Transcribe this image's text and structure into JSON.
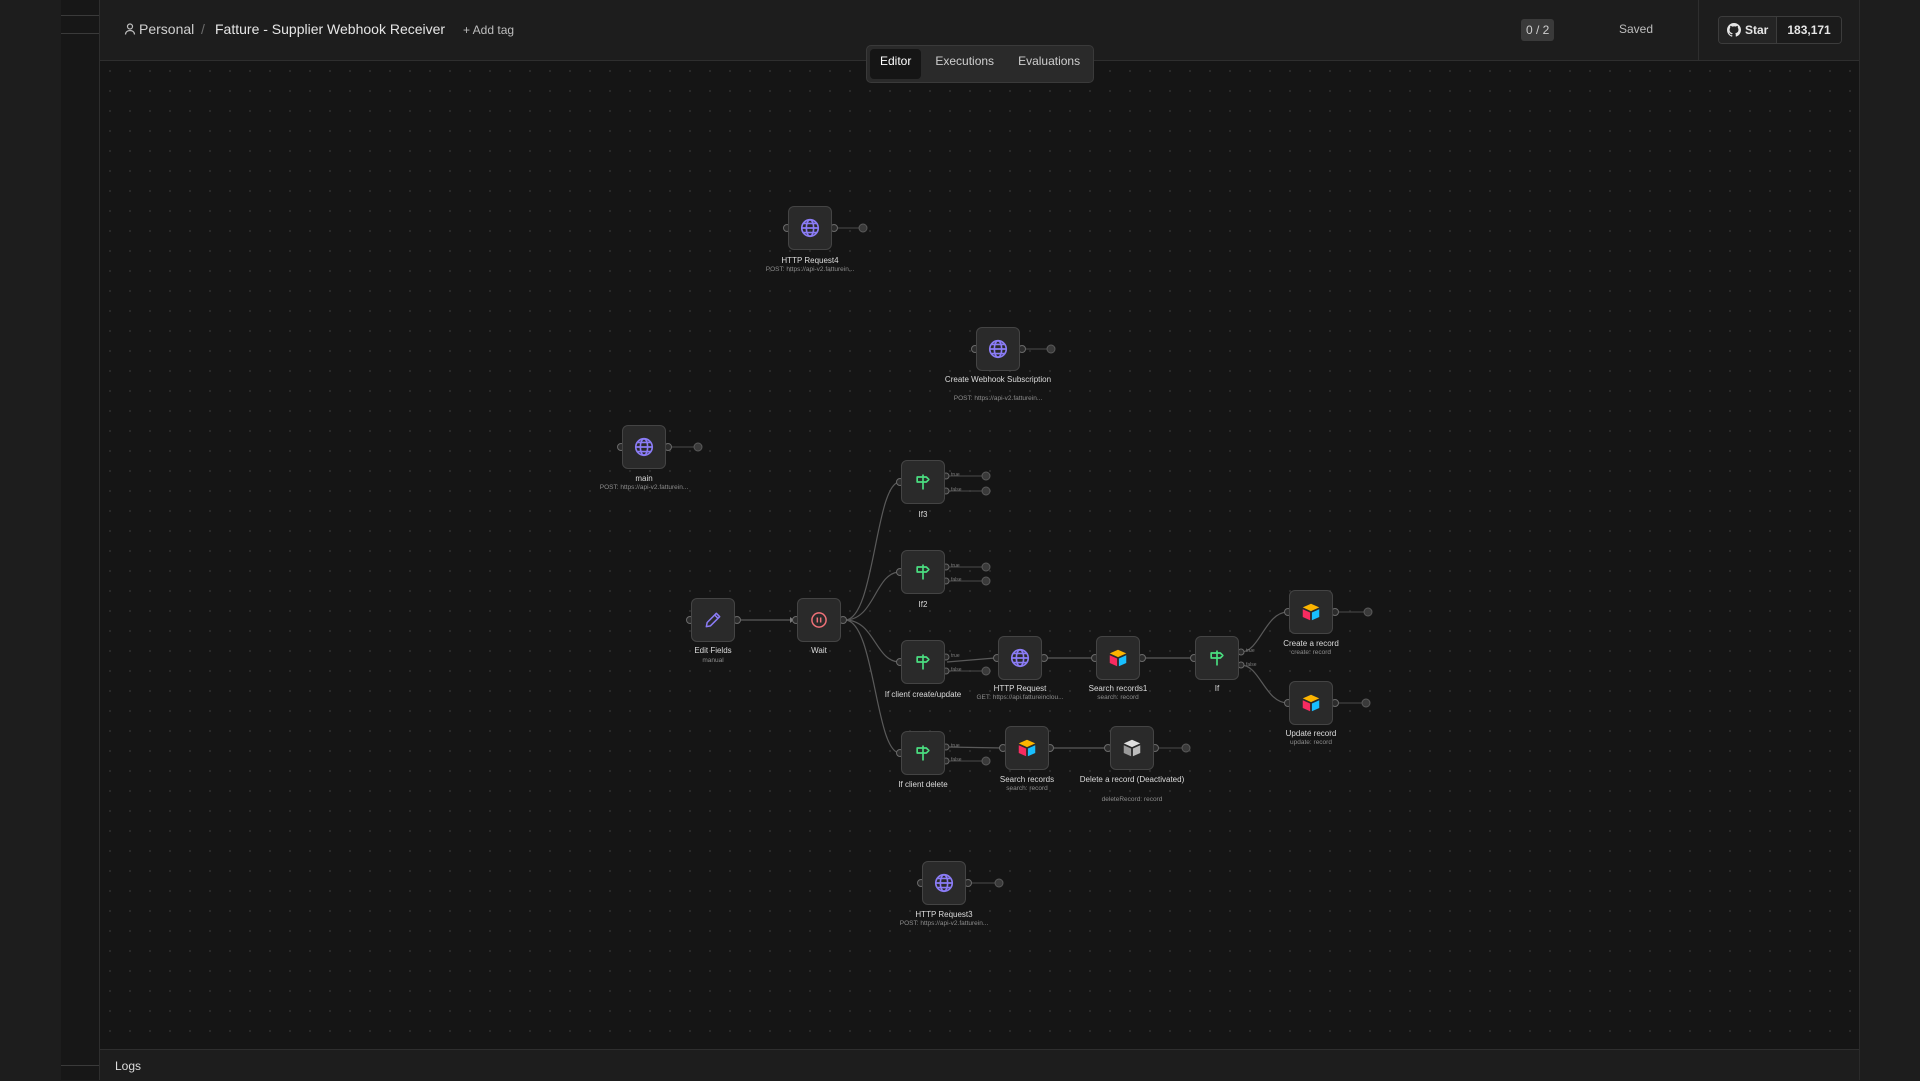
{
  "header": {
    "project": "Personal",
    "separator": "/",
    "workflow_title": "Fatture - Supplier Webhook Receiver",
    "add_tag": "+ Add tag",
    "counter": "0 / 2",
    "status": "Saved",
    "github_star": "Star",
    "github_count": "183,171"
  },
  "tabs": [
    "Editor",
    "Executions",
    "Evaluations"
  ],
  "active_tab": "Editor",
  "nodes": {
    "http_request4": {
      "label": "HTTP Request4",
      "sub": "POST: https://api-v2.fatturein..."
    },
    "create_webhook_subscription": {
      "label": "Create Webhook Subscription",
      "sub": "POST: https://api-v2.fatturein..."
    },
    "main": {
      "label": "main",
      "sub": "POST: https://api-v2.fatturein..."
    },
    "if3": {
      "label": "If3",
      "sub": ""
    },
    "if2": {
      "label": "If2",
      "sub": ""
    },
    "edit_fields": {
      "label": "Edit Fields",
      "sub": "manual"
    },
    "wait": {
      "label": "Wait",
      "sub": ""
    },
    "if_client_create_update": {
      "label": "If client create/update",
      "sub": ""
    },
    "http_request": {
      "label": "HTTP Request",
      "sub": "GET: https://api.fattureinclou..."
    },
    "search_records1": {
      "label": "Search records1",
      "sub": "search: record"
    },
    "if": {
      "label": "If",
      "sub": ""
    },
    "create_a_record": {
      "label": "Create a record",
      "sub": "create: record"
    },
    "update_record": {
      "label": "Update record",
      "sub": "update: record"
    },
    "if_client_delete": {
      "label": "If client delete",
      "sub": ""
    },
    "search_records": {
      "label": "Search records",
      "sub": "search: record"
    },
    "delete_a_record": {
      "label": "Delete a record (Deactivated)",
      "sub": "deleteRecord: record"
    },
    "http_request3": {
      "label": "HTTP Request3",
      "sub": "POST: https://api-v2.fatturein..."
    }
  },
  "port_labels": {
    "true": "true",
    "false": "false"
  },
  "footer": {
    "logs": "Logs"
  },
  "colors": {
    "http_icon": "#8b7cf6",
    "if_icon": "#4ade80",
    "edit_icon": "#8b7cf6",
    "wait_icon": "#f07178",
    "airtable_yellow": "#fcb400",
    "airtable_blue": "#18bfff",
    "airtable_red": "#f82b60"
  }
}
